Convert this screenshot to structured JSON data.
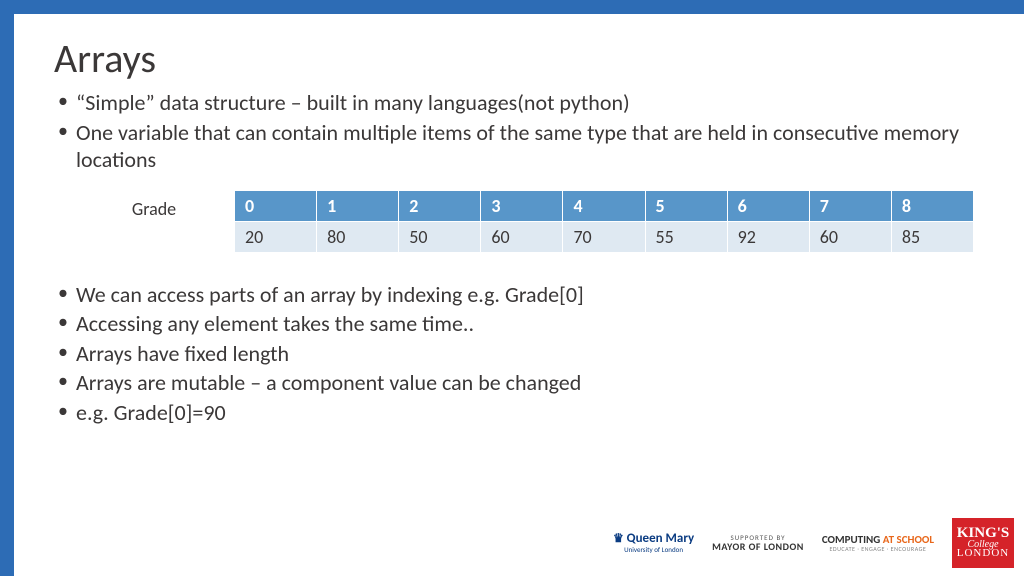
{
  "title": "Arrays",
  "bullets_top": [
    "“Simple” data structure – built in many languages(not python)",
    "One variable that can contain multiple items of the same type that are held in consecutive memory locations"
  ],
  "table": {
    "label": "Grade",
    "indices": [
      "0",
      "1",
      "2",
      "3",
      "4",
      "5",
      "6",
      "7",
      "8"
    ],
    "values": [
      "20",
      "80",
      "50",
      "60",
      "70",
      "55",
      "92",
      "60",
      "85"
    ]
  },
  "bullets_bottom": [
    "We can access parts of an array by indexing e.g. Grade[0]",
    "Accessing any element takes the same time..",
    "Arrays have fixed length",
    "Arrays are mutable – a component value can be changed",
    "e.g. Grade[0]=90"
  ],
  "logos": {
    "qm_crown": "♛",
    "qm_name": "Queen Mary",
    "qm_sub": "University of London",
    "mayor_top": "SUPPORTED BY",
    "mayor_main": "MAYOR OF LONDON",
    "cas_a": "COMPUTING ",
    "cas_b": "AT SCHOOL",
    "cas_sub": "EDUCATE · ENGAGE · ENCOURAGE",
    "kings_a": "KING'S",
    "kings_b": "College",
    "kings_c": "LONDON"
  }
}
